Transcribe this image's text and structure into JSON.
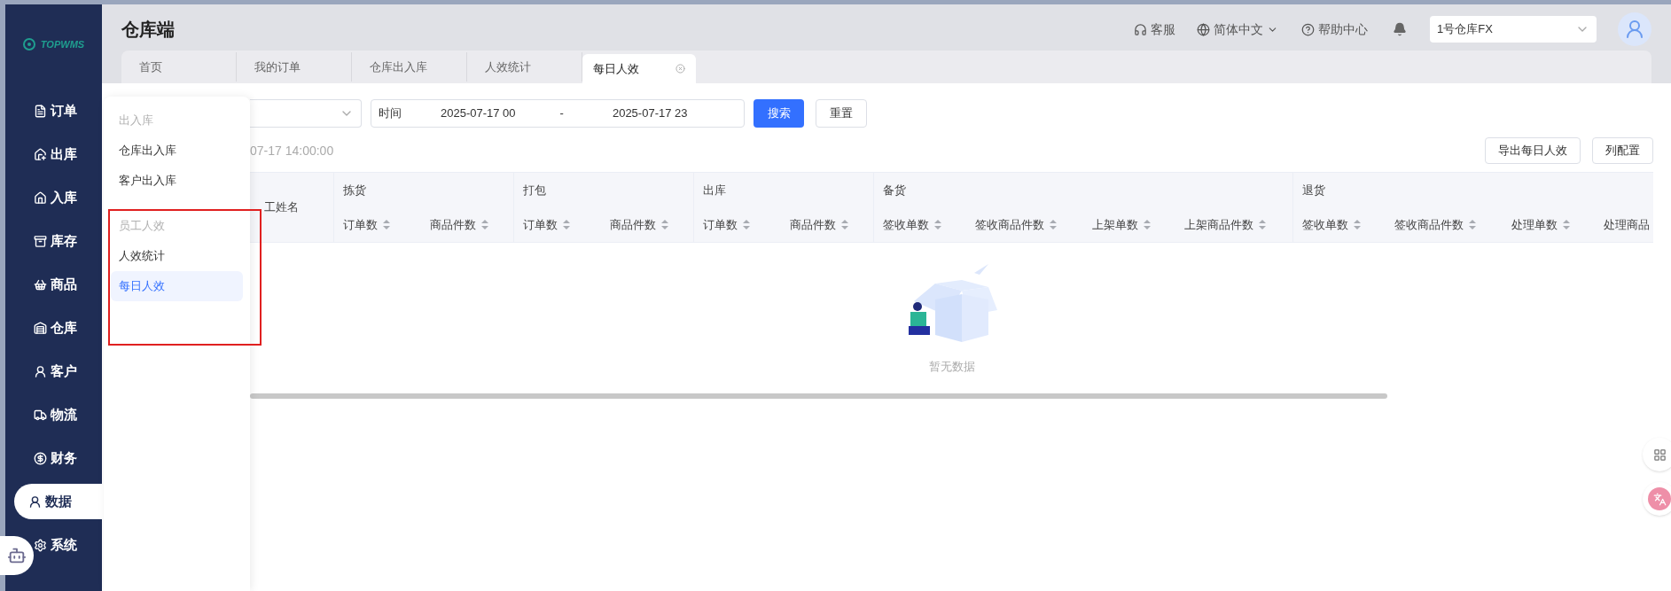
{
  "app": {
    "logo": "TOPWMS",
    "title": "仓库端"
  },
  "sidebar": {
    "items": [
      {
        "label": "订单",
        "kind": "order",
        "selected": false
      },
      {
        "label": "出库",
        "kind": "outbound",
        "selected": false
      },
      {
        "label": "入库",
        "kind": "inbound",
        "selected": false
      },
      {
        "label": "库存",
        "kind": "stock",
        "selected": false
      },
      {
        "label": "商品",
        "kind": "goods",
        "selected": false
      },
      {
        "label": "仓库",
        "kind": "warehouse",
        "selected": false
      },
      {
        "label": "客户",
        "kind": "customer",
        "selected": false
      },
      {
        "label": "物流",
        "kind": "logistics",
        "selected": false
      },
      {
        "label": "财务",
        "kind": "finance",
        "selected": false
      },
      {
        "label": "数据",
        "kind": "data",
        "selected": true
      },
      {
        "label": "系统",
        "kind": "system",
        "selected": false
      }
    ]
  },
  "header": {
    "service": "客服",
    "language": "简体中文",
    "help": "帮助中心",
    "warehouse": "1号仓库FX"
  },
  "tabs": [
    {
      "label": "首页",
      "selected": false
    },
    {
      "label": "我的订单",
      "selected": false
    },
    {
      "label": "仓库出入库",
      "selected": false
    },
    {
      "label": "人效统计",
      "selected": false
    },
    {
      "label": "每日人效",
      "selected": true
    }
  ],
  "popup_menu": {
    "groups": [
      {
        "title": "出入库",
        "items": [
          {
            "label": "仓库出入库",
            "selected": false
          },
          {
            "label": "客户出入库",
            "selected": false
          }
        ]
      },
      {
        "title": "员工人效",
        "items": [
          {
            "label": "人效统计",
            "selected": false
          },
          {
            "label": "每日人效",
            "selected": true
          }
        ]
      }
    ]
  },
  "filter": {
    "time_label": "时间",
    "start": "2025-07-17 00",
    "separator": "-",
    "end": "2025-07-17 23",
    "search": "搜索",
    "reset": "重置"
  },
  "timestamp": "07-17 14:00:00",
  "actions": [
    "导出每日人效",
    "列配置"
  ],
  "table": {
    "first_column": "工姓名",
    "groups": [
      {
        "label": "拣货",
        "columns": [
          "订单数",
          "商品件数"
        ]
      },
      {
        "label": "打包",
        "columns": [
          "订单数",
          "商品件数"
        ]
      },
      {
        "label": "出库",
        "columns": [
          "订单数",
          "商品件数"
        ]
      },
      {
        "label": "备货",
        "columns": [
          "签收单数",
          "签收商品件数",
          "上架单数",
          "上架商品件数"
        ]
      },
      {
        "label": "退货",
        "columns": [
          "签收单数",
          "签收商品件数",
          "处理单数",
          "处理商品"
        ]
      }
    ],
    "empty_text": "暂无数据"
  }
}
